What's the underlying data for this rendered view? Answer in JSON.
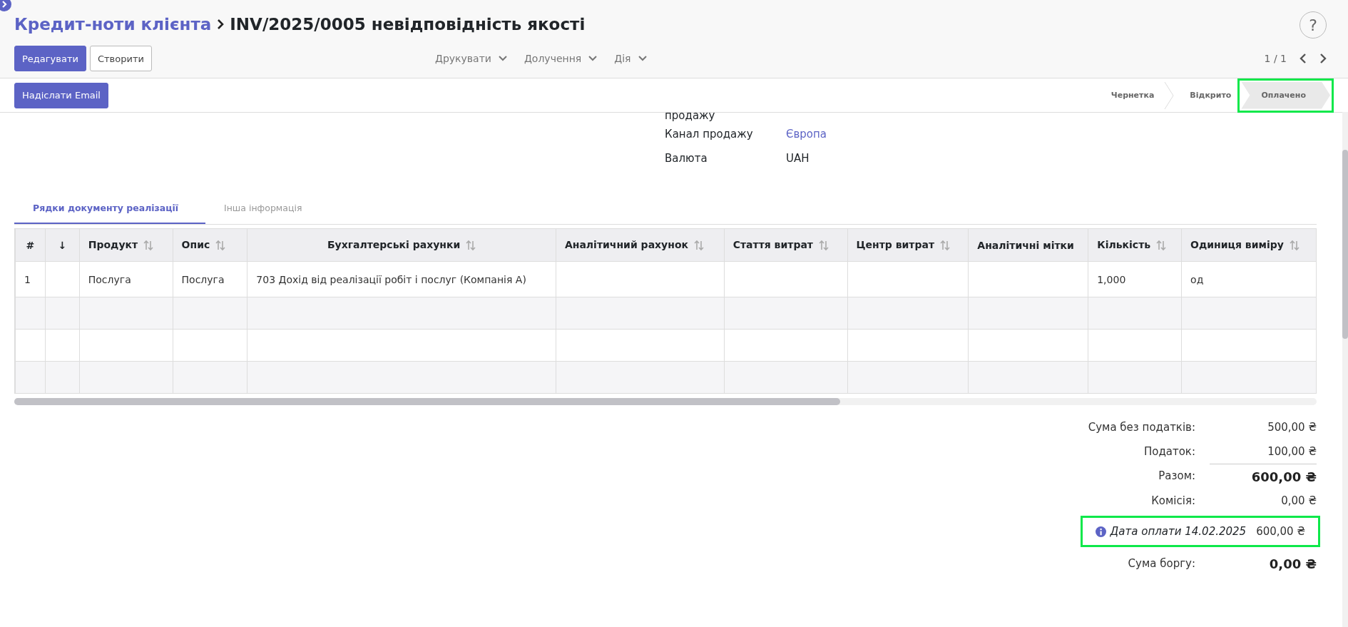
{
  "breadcrumb": {
    "parent": "Кредит-ноти клієнта",
    "current": "INV/2025/0005 невідповідність якості"
  },
  "buttons": [
    "Редагувати",
    "Створити"
  ],
  "menus": [
    "Друкувати",
    "Долучення",
    "Дія"
  ],
  "help": "?",
  "pager": "1 / 1",
  "status_actions": [
    "Надіслати Email"
  ],
  "status_steps": [
    {
      "label": "Чернетка",
      "selected": false
    },
    {
      "label": "Відкрито",
      "selected": false
    },
    {
      "label": "Оплачено",
      "selected": true
    }
  ],
  "fields": [
    {
      "label": "продажу",
      "kind": "cut"
    },
    {
      "label": "Канал продажу",
      "value": "Європа",
      "kind": "link"
    },
    {
      "label": "Валюта",
      "value": "UAH",
      "kind": "text"
    }
  ],
  "tabs": [
    {
      "label": "Рядки документу реалізації",
      "selected": true
    },
    {
      "label": "Інша інформація",
      "selected": false
    }
  ],
  "table": {
    "columns": [
      {
        "label": "#",
        "sortable": false
      },
      {
        "label": "↓",
        "sortable": false
      },
      {
        "label": "Продукт",
        "sortable": true
      },
      {
        "label": "Опис",
        "sortable": true
      },
      {
        "label": "Бухгалтерські рахунки",
        "sortable": true
      },
      {
        "label": "Аналітичний рахунок",
        "sortable": true
      },
      {
        "label": "Стаття витрат",
        "sortable": true
      },
      {
        "label": "Центр витрат",
        "sortable": true
      },
      {
        "label": "Аналітичні мітки",
        "sortable": false
      },
      {
        "label": "Кількість",
        "sortable": true
      },
      {
        "label": "Одиниця виміру",
        "sortable": true
      }
    ],
    "rows": [
      [
        "1",
        "",
        "Послуга",
        "Послуга",
        "703 Дохід від реалізації робіт і послуг (Компанія А)",
        "",
        "",
        "",
        "",
        "1,000",
        "од"
      ]
    ]
  },
  "totals": [
    {
      "label": "Сума без податків:",
      "value": "500,00 ₴",
      "kind": "plain"
    },
    {
      "label": "Податок:",
      "value": "100,00 ₴",
      "kind": "plain"
    },
    {
      "label": "Разом:",
      "value": "600,00 ₴",
      "kind": "total"
    },
    {
      "label": "Комісія:",
      "value": "0,00 ₴",
      "kind": "plain"
    },
    {
      "label": "Дата оплати 14.02.2025",
      "value": "600,00 ₴",
      "kind": "payment"
    },
    {
      "label": "Сума боргу:",
      "value": "0,00 ₴",
      "kind": "total"
    }
  ]
}
